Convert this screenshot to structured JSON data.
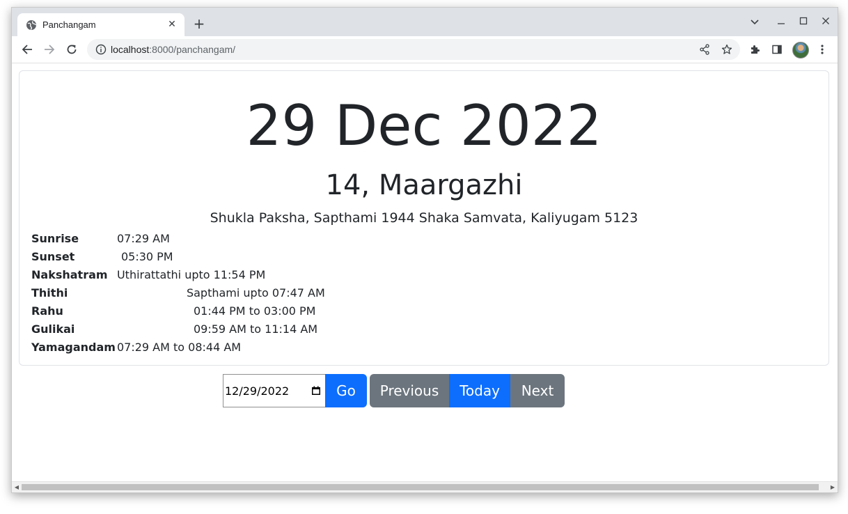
{
  "browser": {
    "tab_title": "Panchangam",
    "url_host": "localhost",
    "url_path": ":8000/panchangam/"
  },
  "page": {
    "date_heading": "29 Dec 2022",
    "tamil_date": "14, Maargazhi",
    "subline": "Shukla Paksha, Sapthami 1944 Shaka Samvata, Kaliyugam 5123",
    "details": [
      {
        "label": "Sunrise",
        "value": "07:29 AM"
      },
      {
        "label": "Sunset",
        "value": "05:30 PM"
      },
      {
        "label": "Nakshatram",
        "value": "Uthirattathi upto 11:54 PM"
      },
      {
        "label": "Thithi",
        "value": "Sapthami upto 07:47 AM"
      },
      {
        "label": "Rahu",
        "value": "01:44 PM to 03:00 PM"
      },
      {
        "label": "Gulikai",
        "value": "09:59 AM to 11:14 AM"
      },
      {
        "label": "Yamagandam",
        "value": "07:29 AM to 08:44 AM"
      }
    ]
  },
  "controls": {
    "date_value": "12/29/2022",
    "go_label": "Go",
    "previous_label": "Previous",
    "today_label": "Today",
    "next_label": "Next"
  },
  "colors": {
    "primary": "#0d6efd",
    "secondary": "#6c757d"
  }
}
